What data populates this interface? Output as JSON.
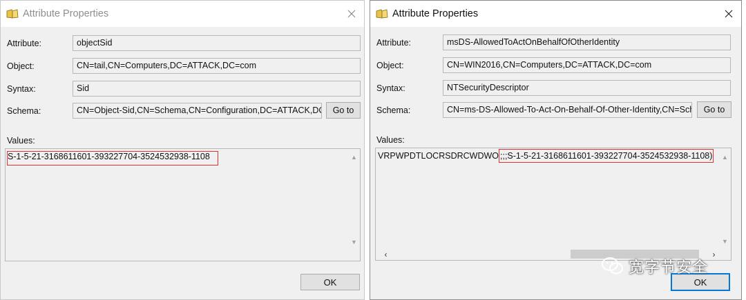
{
  "left": {
    "title": "Attribute Properties",
    "labels": {
      "attribute": "Attribute:",
      "object": "Object:",
      "syntax": "Syntax:",
      "schema": "Schema:",
      "values": "Values:"
    },
    "attribute": "objectSid",
    "object": "CN=tail,CN=Computers,DC=ATTACK,DC=com",
    "syntax": "Sid",
    "schema": "CN=Object-Sid,CN=Schema,CN=Configuration,DC=ATTACK,DC",
    "goto_label": "Go to",
    "value": "S-1-5-21-3168611601-393227704-3524532938-1108",
    "ok_label": "OK"
  },
  "right": {
    "title": "Attribute Properties",
    "labels": {
      "attribute": "Attribute:",
      "object": "Object:",
      "syntax": "Syntax:",
      "schema": "Schema:",
      "values": "Values:"
    },
    "attribute": "msDS-AllowedToActOnBehalfOfOtherIdentity",
    "object": "CN=WIN2016,CN=Computers,DC=ATTACK,DC=com",
    "syntax": "NTSecurityDescriptor",
    "schema": "CN=ms-DS-Allowed-To-Act-On-Behalf-Of-Other-Identity,CN=Sch",
    "goto_label": "Go to",
    "value_prefix": "VRPWPDTLOCRSDRCWDWO",
    "value_highlight": ";;;S-1-5-21-3168611601-393227704-3524532938-1108)",
    "ok_label": "OK"
  },
  "watermark": "宽字节安全",
  "colors": {
    "highlight": "#e03030",
    "focus": "#0078d7",
    "dialog_bg": "#f0f0f0"
  }
}
